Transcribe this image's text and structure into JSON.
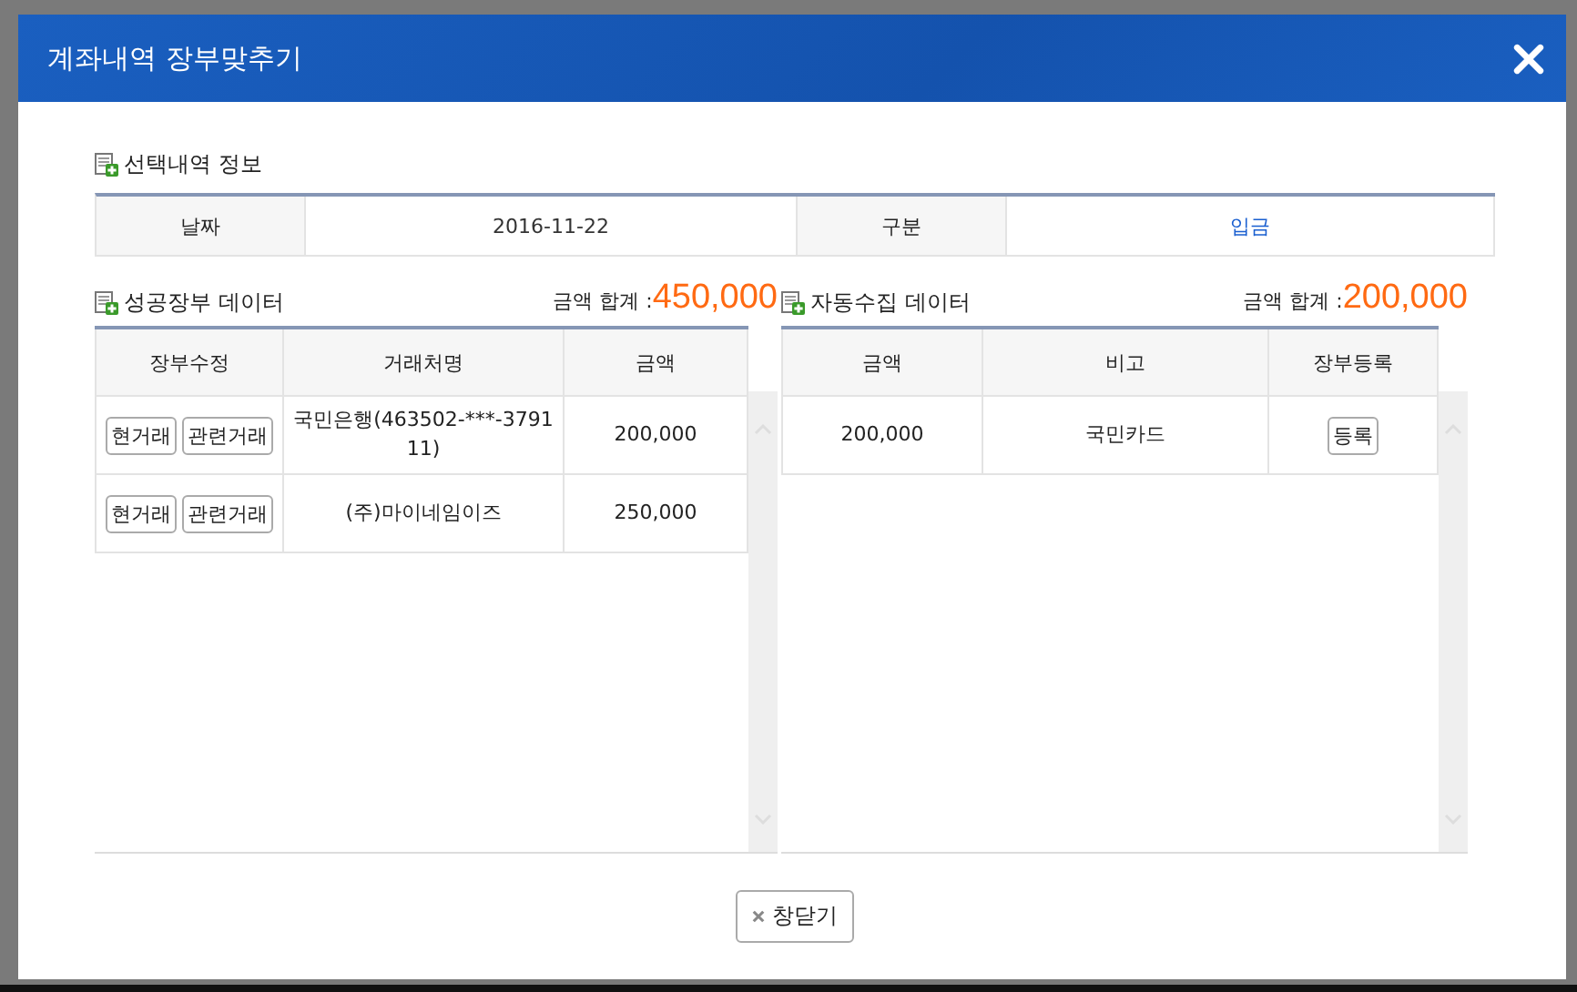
{
  "window": {
    "title": "계좌내역 장부맞추기"
  },
  "selection": {
    "title": "선택내역 정보",
    "fields": [
      {
        "label": "날짜",
        "value": "2016-11-22",
        "kind": "plain"
      },
      {
        "label": "구분",
        "value": "입금",
        "kind": "link"
      }
    ]
  },
  "ledger": {
    "title": "성공장부 데이터",
    "total_label": "금액 합계 :",
    "total": "450,000",
    "columns": [
      "장부수정",
      "거래처명",
      "금액"
    ],
    "rows": [
      {
        "actions": [
          "현거래",
          "관련거래"
        ],
        "name": "국민은행(463502-***-379111)",
        "amount": "200,000"
      },
      {
        "actions": [
          "현거래",
          "관련거래"
        ],
        "name": "(주)마이네임이즈",
        "amount": "250,000"
      }
    ]
  },
  "collected": {
    "title": "자동수집 데이터",
    "total_label": "금액 합계 :",
    "total": "200,000",
    "columns": [
      "금액",
      "비고",
      "장부등록"
    ],
    "rows": [
      {
        "amount": "200,000",
        "note": "국민카드",
        "action": "등록"
      }
    ]
  },
  "footer": {
    "close_button": "창닫기"
  }
}
